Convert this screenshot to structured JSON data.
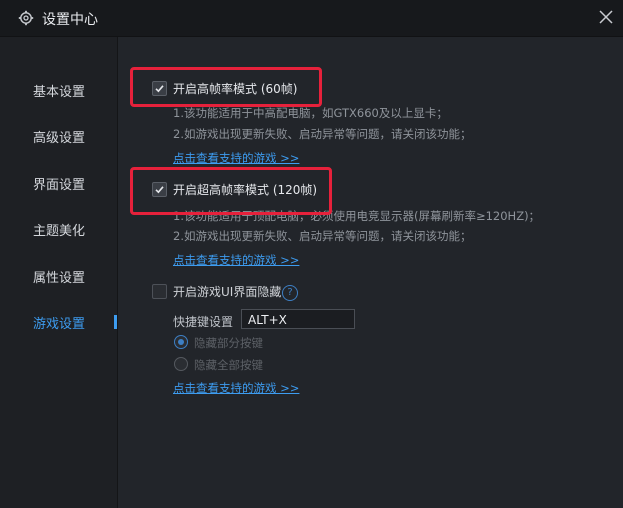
{
  "window": {
    "title": "设置中心",
    "icons": {
      "settings": "gear-icon",
      "close": "close-icon"
    }
  },
  "sidebar": {
    "items": [
      {
        "label": "基本设置",
        "active": false
      },
      {
        "label": "高级设置",
        "active": false
      },
      {
        "label": "界面设置",
        "active": false
      },
      {
        "label": "主题美化",
        "active": false
      },
      {
        "label": "属性设置",
        "active": false
      },
      {
        "label": "游戏设置",
        "active": true
      }
    ]
  },
  "game": {
    "high_fps": {
      "label": "开启高帧率模式 (60帧)",
      "checked": true,
      "notes": [
        "1.该功能适用于中高配电脑，如GTX660及以上显卡；",
        "2.如游戏出现更新失败、启动异常等问题，请关闭该功能；"
      ],
      "link": "点击查看支持的游戏 >>"
    },
    "ultra_fps": {
      "label": "开启超高帧率模式 (120帧)",
      "checked": true,
      "notes": [
        "1.该功能适用于顶配电脑，必须使用电竞显示器(屏幕刷新率≥120HZ)；",
        "2.如游戏出现更新失败、启动异常等问题，请关闭该功能；"
      ],
      "link": "点击查看支持的游戏 >>"
    },
    "hide_ui": {
      "label": "开启游戏UI界面隐藏",
      "checked": false,
      "help_icon": "question-icon",
      "hotkey_label": "快捷键设置",
      "hotkey_value": "ALT+X",
      "radio_options": [
        {
          "label": "隐藏部分按键",
          "selected": true
        },
        {
          "label": "隐藏全部按键",
          "selected": false
        }
      ],
      "link": "点击查看支持的游戏 >>"
    }
  },
  "colors": {
    "accent": "#3d9cf0",
    "highlight": "#e6213b"
  }
}
